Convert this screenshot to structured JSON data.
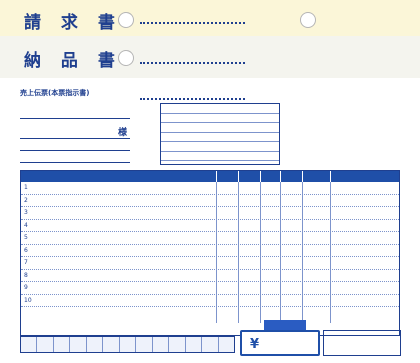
{
  "header": {
    "title_1": "請 求 書",
    "title_2": "納 品 書",
    "label_billing": "売上伝票(本票指示書)",
    "label_sama": "様"
  },
  "grid": {
    "row_numbers": [
      "1",
      "2",
      "3",
      "4",
      "5",
      "6",
      "7",
      "8",
      "9",
      "10"
    ],
    "total_symbol": "¥"
  },
  "colors": {
    "accent": "#1f4fa8",
    "header_band": "#fbf6d8"
  }
}
